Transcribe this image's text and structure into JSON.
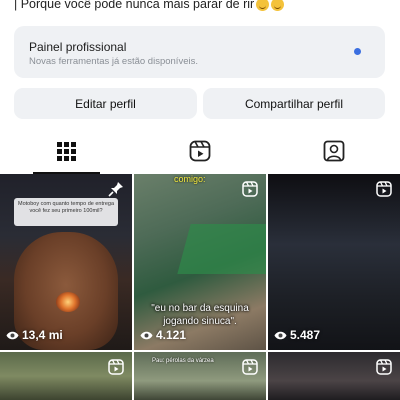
{
  "profile": {
    "bio_line": "| Porque você pode nunca mais parar de rir",
    "bio_emojis": [
      "laughing-emoji",
      "laughing-emoji"
    ]
  },
  "professional_panel": {
    "title": "Painel profissional",
    "subtitle": "Novas ferramentas já estão disponíveis.",
    "dot_color": "#3b6fe0"
  },
  "actions": {
    "edit_label": "Editar perfil",
    "share_label": "Compartilhar perfil"
  },
  "tabs": [
    {
      "icon": "grid-icon",
      "active": true
    },
    {
      "icon": "reels-icon",
      "active": false
    },
    {
      "icon": "tagged-icon",
      "active": false
    }
  ],
  "posts": [
    {
      "overlay_text": "Motoboy com quanto tempo de entrega você fez seu primeiro 100mil?",
      "views": "13,4 mi",
      "corner_icon": "pin-icon"
    },
    {
      "overlay_top": "comigo:",
      "overlay_text": "\"eu no bar da esquina jogando sinuca\".",
      "views": "4.121",
      "corner_icon": "reel-icon"
    },
    {
      "views": "5.487",
      "corner_icon": "reel-icon"
    },
    {
      "corner_icon": "reel-icon"
    },
    {
      "overlay_top": "Pau: pérolas da várzea",
      "corner_icon": "reel-icon"
    },
    {
      "corner_icon": "reel-icon"
    }
  ],
  "colors": {
    "panel_bg": "#eff1f4",
    "accent_blue": "#3b6fe0"
  }
}
